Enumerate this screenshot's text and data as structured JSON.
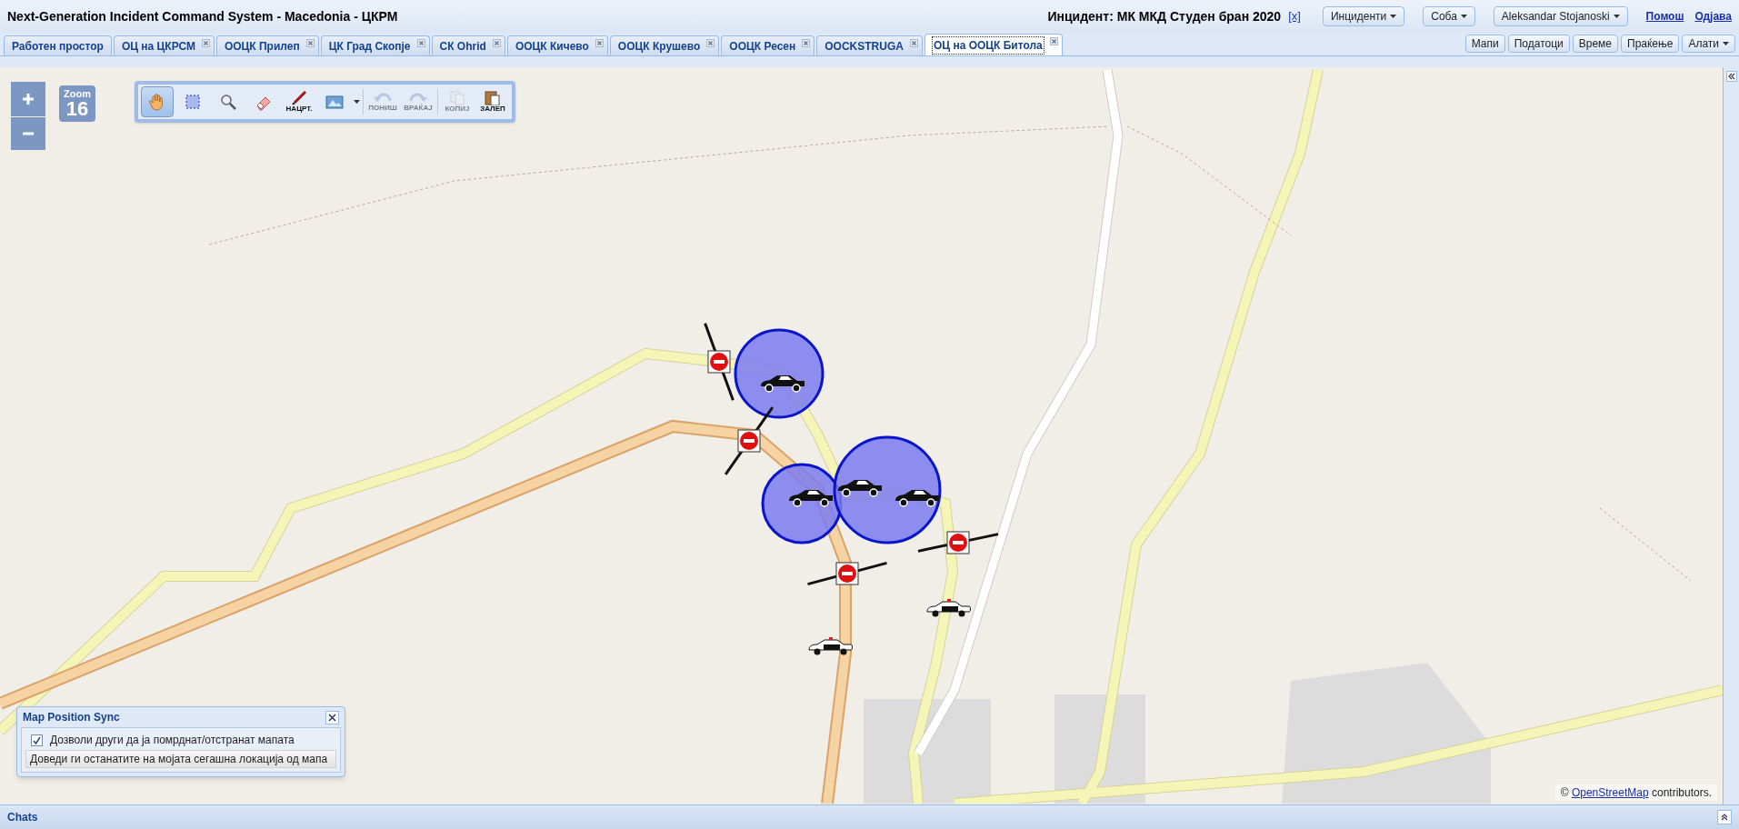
{
  "window": {
    "title": "Next-Generation Incident Command System - Macedonia - ЦКРМ"
  },
  "header": {
    "incident": "Инцидент: МК МКД Студен бран 2020",
    "incident_close": "[x]",
    "menus": [
      "Инциденти",
      "Соба",
      "Aleksandar Stojanoski"
    ],
    "links": [
      "Помош",
      "Одјава"
    ]
  },
  "tabs": [
    {
      "label": "Работен простор",
      "closable": false,
      "selected": false
    },
    {
      "label": "ОЦ на ЦКРСМ",
      "closable": true,
      "selected": false
    },
    {
      "label": "ООЦК Прилеп",
      "closable": true,
      "selected": false
    },
    {
      "label": "ЦК Град Скопје",
      "closable": true,
      "selected": false
    },
    {
      "label": "СК Ohrid",
      "closable": true,
      "selected": false
    },
    {
      "label": "ООЦК Кичево",
      "closable": true,
      "selected": false
    },
    {
      "label": "ООЦК Крушево",
      "closable": true,
      "selected": false
    },
    {
      "label": "ООЦК Ресен",
      "closable": true,
      "selected": false
    },
    {
      "label": "OOCKSTRUGA",
      "closable": true,
      "selected": false
    },
    {
      "label": "ОЦ на ООЦК Битола",
      "closable": true,
      "selected": true
    }
  ],
  "view_buttons": [
    {
      "label": "Мапи",
      "dropdown": false
    },
    {
      "label": "Податоци",
      "dropdown": false
    },
    {
      "label": "Време",
      "dropdown": false
    },
    {
      "label": "Праќење",
      "dropdown": false
    },
    {
      "label": "Алати",
      "dropdown": true
    }
  ],
  "zoom": {
    "label": "Zoom",
    "level_text": "16"
  },
  "toolbar": [
    {
      "kind": "pan",
      "selected": true,
      "disabled": false
    },
    {
      "kind": "select",
      "selected": false,
      "disabled": false
    },
    {
      "kind": "magnify",
      "selected": false,
      "disabled": false
    },
    {
      "kind": "erase",
      "selected": false,
      "disabled": false
    },
    {
      "kind": "draw",
      "label": "НАЦРТ.",
      "selected": false,
      "disabled": false
    },
    {
      "kind": "layers",
      "selected": false,
      "disabled": false
    },
    {
      "kind": "undo",
      "label": "ПОНИШ",
      "selected": false,
      "disabled": true
    },
    {
      "kind": "redo",
      "label": "ВРАЌАЈ",
      "selected": false,
      "disabled": true
    },
    {
      "kind": "copy",
      "label": "КОПИЈ",
      "selected": false,
      "disabled": true
    },
    {
      "kind": "paste",
      "label": "ЗАЛЕП",
      "selected": false,
      "disabled": false
    }
  ],
  "map_markers": [
    {
      "kind": "zone"
    },
    {
      "kind": "zone"
    },
    {
      "kind": "zone"
    },
    {
      "kind": "car"
    },
    {
      "kind": "car"
    },
    {
      "kind": "car"
    },
    {
      "kind": "car"
    },
    {
      "kind": "no_entry"
    },
    {
      "kind": "no_entry"
    },
    {
      "kind": "no_entry"
    },
    {
      "kind": "no_entry"
    },
    {
      "kind": "police"
    },
    {
      "kind": "police"
    }
  ],
  "sync_panel": {
    "title": "Map Position Sync",
    "checkbox": {
      "label": "Дозволи други да ја помрднат/отстранат мапата",
      "checked": true
    },
    "button": "Доведи ги останатите на мојата сегашна локација од мапа"
  },
  "attribution": {
    "prefix": "©",
    "link": "OpenStreetMap",
    "suffix": "contributors."
  },
  "chats": {
    "title": "Chats"
  }
}
